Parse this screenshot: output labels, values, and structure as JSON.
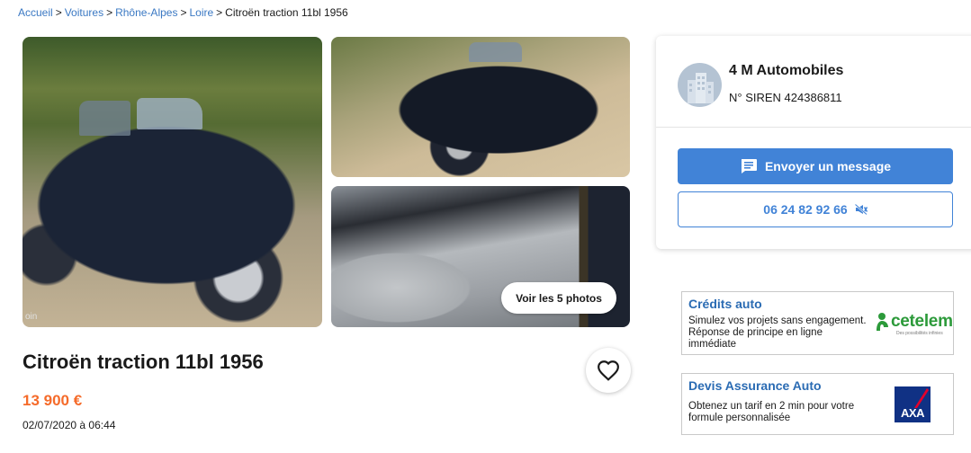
{
  "breadcrumb": {
    "items": [
      "Accueil",
      "Voitures",
      "Rhône-Alpes",
      "Loire"
    ],
    "current": "Citroën traction 11bl 1956",
    "separator": ">"
  },
  "gallery": {
    "see_photos_label": "Voir les 5 photos",
    "watermark": "oin"
  },
  "listing": {
    "title": "Citroën traction 11bl 1956",
    "price": "13 900 €",
    "date": "02/07/2020 à 06:44",
    "favorite_icon": "heart-outline-icon"
  },
  "seller": {
    "name": "4 M Automobiles",
    "siren": "N° SIREN 424386811",
    "avatar_icon": "building-icon",
    "message_label": "Envoyer un message",
    "message_icon": "chat-icon",
    "phone": "06 24 82 92 66",
    "phone_icon": "megaphone-muted-icon"
  },
  "ads": {
    "credit": {
      "title": "Crédits auto",
      "text": "Simulez vos projets sans engagement. Réponse de principe en ligne immédiate",
      "logo": "cetelem",
      "logo_tagline": "Des possibilités infinies"
    },
    "insurance": {
      "title": "Devis Assurance Auto",
      "text": "Obtenez un tarif en 2 min pour votre formule personnalisée",
      "logo": "AXA"
    }
  },
  "colors": {
    "accent": "#4183d7",
    "price": "#f56b2a",
    "link": "#3a78c3",
    "ad_title": "#2a6bb3"
  }
}
